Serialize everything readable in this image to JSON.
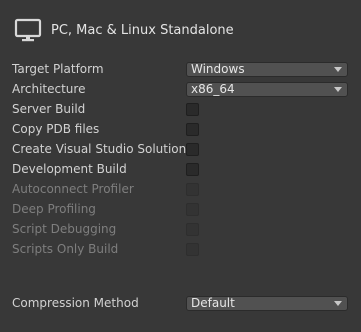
{
  "header": {
    "icon": "monitor-icon",
    "title": "PC, Mac & Linux Standalone"
  },
  "settings": {
    "target_platform": {
      "label": "Target Platform",
      "value": "Windows"
    },
    "architecture": {
      "label": "Architecture",
      "value": "x86_64"
    },
    "server_build": {
      "label": "Server Build",
      "checked": false
    },
    "copy_pdb_files": {
      "label": "Copy PDB files",
      "checked": false
    },
    "create_vs_solution": {
      "label": "Create Visual Studio Solution",
      "checked": false
    },
    "development_build": {
      "label": "Development Build",
      "checked": false
    },
    "autoconnect_profiler": {
      "label": "Autoconnect Profiler",
      "checked": false,
      "enabled": false
    },
    "deep_profiling": {
      "label": "Deep Profiling",
      "checked": false,
      "enabled": false
    },
    "script_debugging": {
      "label": "Script Debugging",
      "checked": false,
      "enabled": false
    },
    "scripts_only_build": {
      "label": "Scripts Only Build",
      "checked": false,
      "enabled": false
    },
    "compression_method": {
      "label": "Compression Method",
      "value": "Default"
    }
  },
  "colors": {
    "background": "#383838",
    "text": "#d2d2d2",
    "disabled_text": "#7e7e7e",
    "dropdown_bg": "#515151"
  }
}
